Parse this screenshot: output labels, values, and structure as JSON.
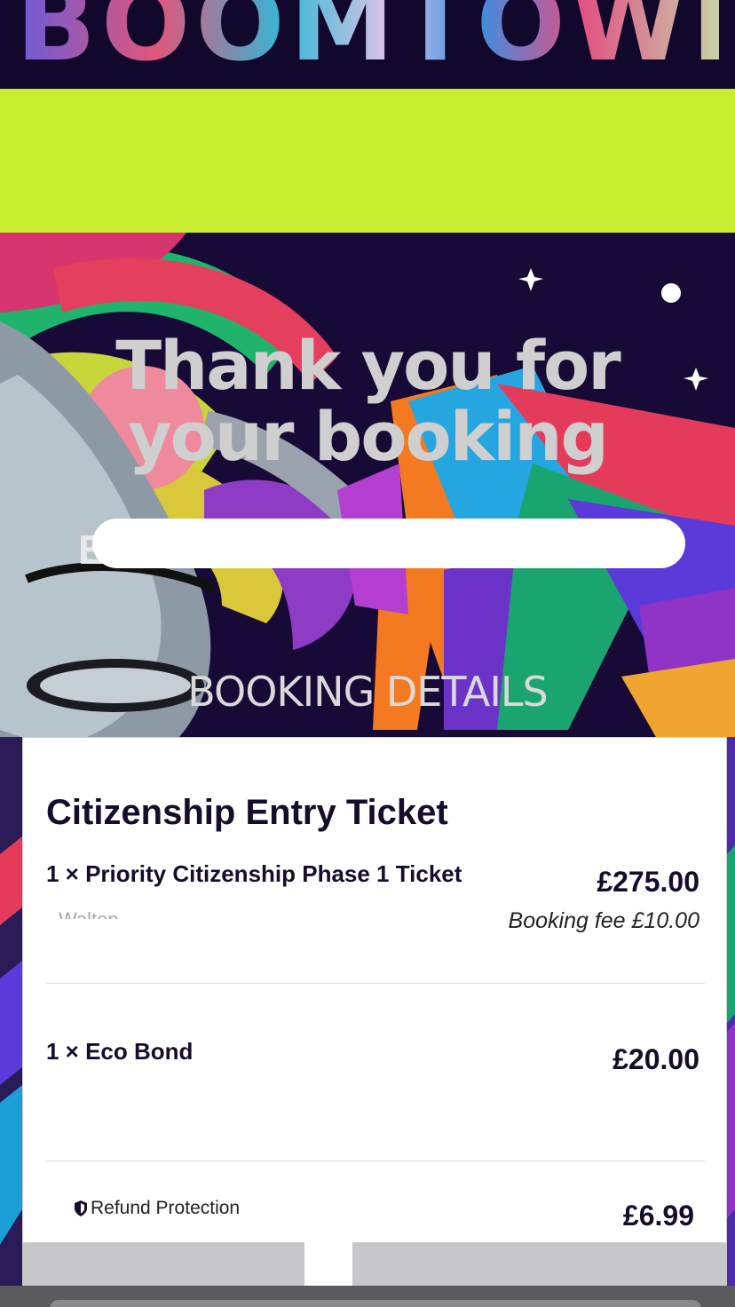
{
  "header": {
    "logo_text": "BOOMTOWN"
  },
  "hero": {
    "title_line1": "Thank you for",
    "title_line2": "your booking",
    "name_initial": "E"
  },
  "section_heading": "BOOKING DETAILS",
  "card": {
    "title": "Citizenship Entry Ticket",
    "items": [
      {
        "label": "1 × Priority Citizenship Phase 1 Ticket",
        "price": "£275.00",
        "fee": "Booking fee £10.00",
        "holder_fragment": "Walton"
      },
      {
        "label": "1 × Eco Bond",
        "price": "£20.00"
      },
      {
        "label": "Refund Protection",
        "price": "£6.99"
      }
    ]
  },
  "colors": {
    "accent_lime": "#c8ec2e",
    "dark_navy": "#170c2b"
  },
  "icons": [
    "shield-icon",
    "star-icon"
  ]
}
